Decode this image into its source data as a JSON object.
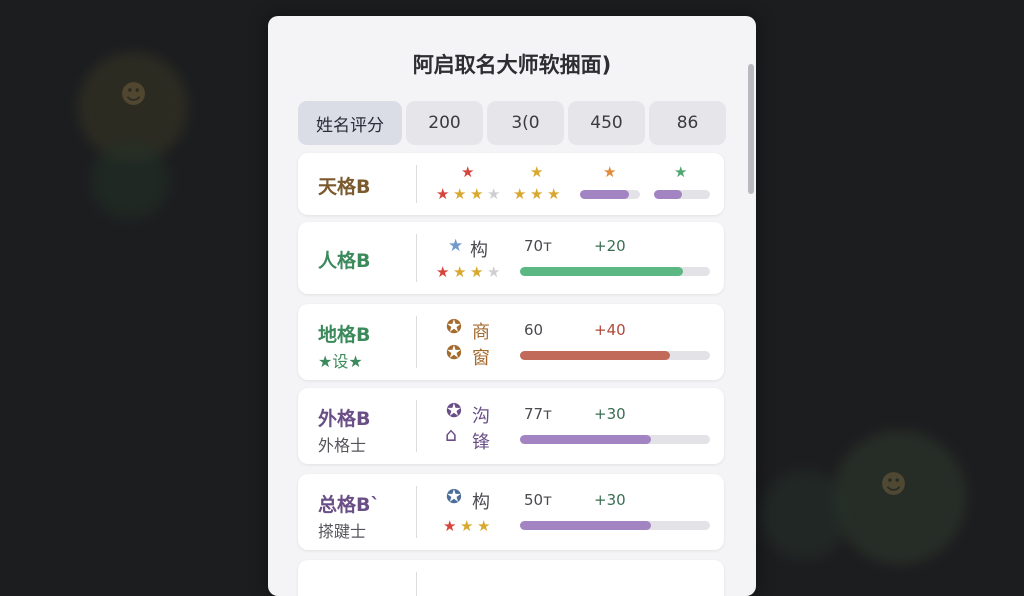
{
  "window": {
    "title": "阿启取名大师软捆面)"
  },
  "tabs": [
    {
      "label": "姓名评分"
    },
    {
      "label": "200"
    },
    {
      "label": "3(0"
    },
    {
      "label": "450"
    },
    {
      "label": "86"
    }
  ],
  "rows": [
    {
      "label": "天格B",
      "label_color": "#7a5a2e"
    },
    {
      "label": "人格B",
      "label_color": "#3c8a5c",
      "value": "70т",
      "delta": "+20",
      "glyph": "构",
      "bar_fraction": 0.86,
      "bar_color": "#5cb883"
    },
    {
      "label": "地格B",
      "label_color": "#3c8a5c",
      "sub": "★设★",
      "value": "60",
      "delta": "+40",
      "glyph": "商",
      "glyph2": "窗",
      "bar_fraction": 0.79,
      "bar_color": "#c26a5a"
    },
    {
      "label": "外格B",
      "label_color": "#6a4f86",
      "sub": "外格士",
      "value": "77т",
      "delta": "+30",
      "glyph": "沟",
      "glyph2": "锋",
      "bar_fraction": 0.69,
      "bar_color": "#a284c2"
    },
    {
      "label": "总格B`",
      "label_color": "#6a4f86",
      "sub": "搽踺士",
      "value": "50т",
      "delta": "+30",
      "glyph": "构",
      "bar_fraction": 0.69,
      "bar_color": "#a284c2"
    }
  ],
  "row1_bars": [
    {
      "fraction": 0.82,
      "color": "#a284c2"
    },
    {
      "fraction": 0.5,
      "color": "#a284c2"
    }
  ],
  "colors": {
    "star_red": "#d6453c",
    "star_gold": "#d9a92f",
    "star_gray": "#cfcfd3",
    "star_blue": "#6f9ac9",
    "star_green": "#4fa772",
    "star_orange": "#e08a3a"
  }
}
